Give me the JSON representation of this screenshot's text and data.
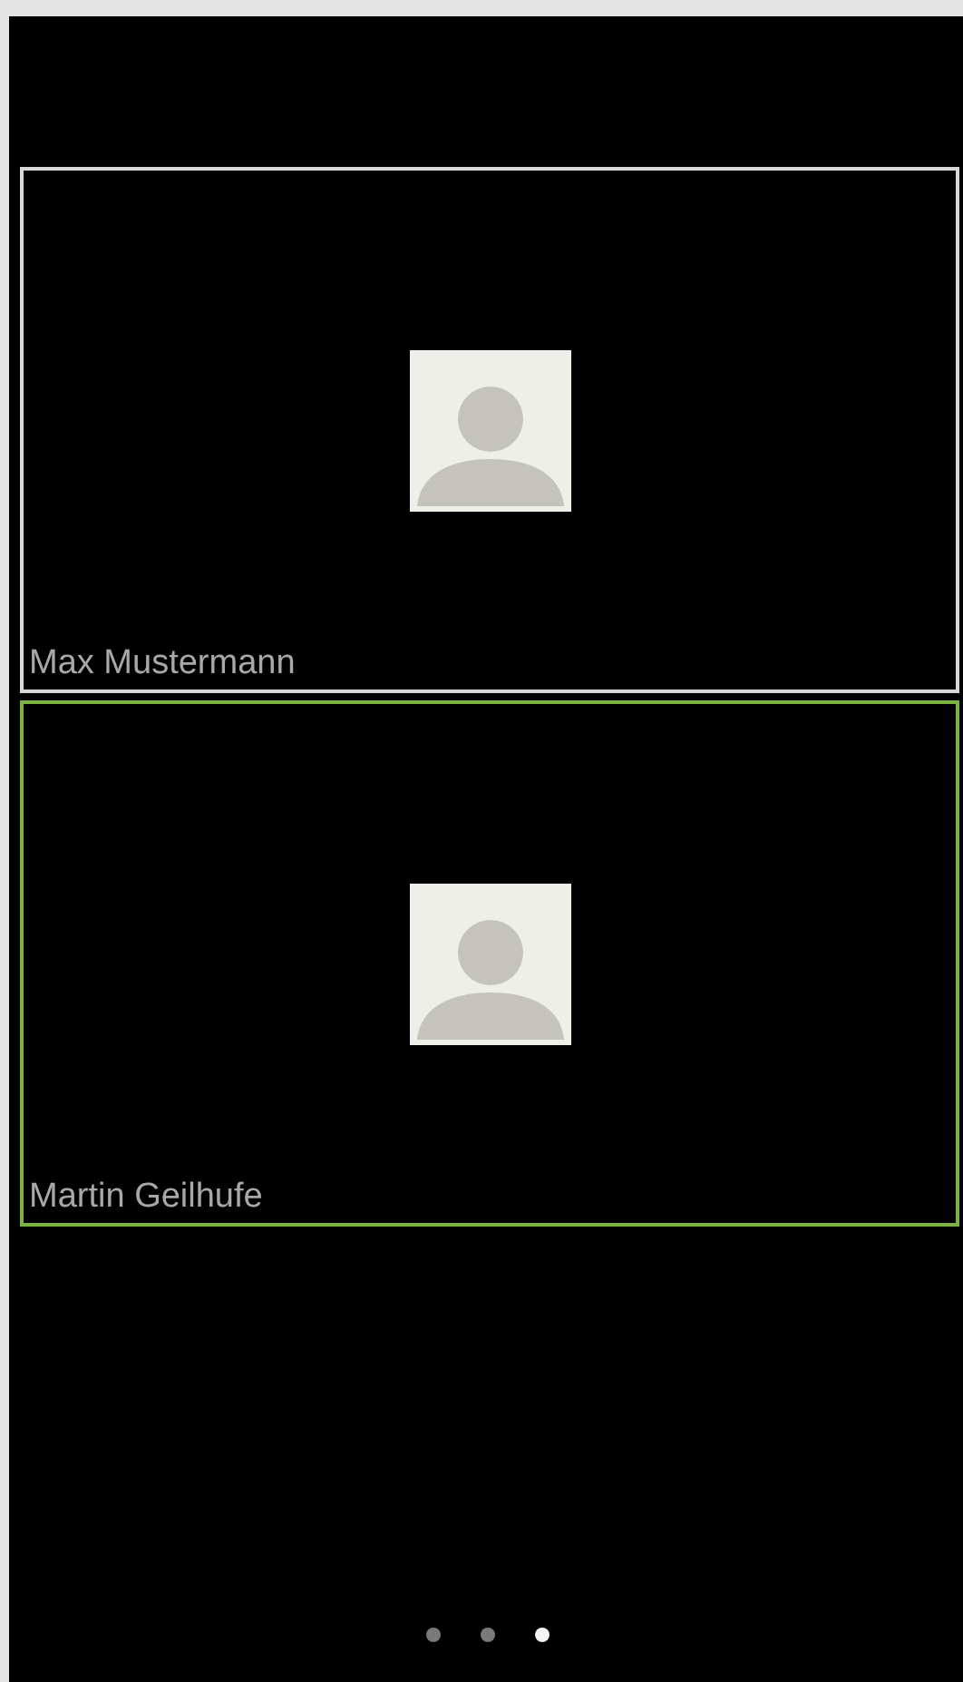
{
  "participants": [
    {
      "name": "Max Mustermann",
      "selected": false
    },
    {
      "name": "Martin Geilhufe",
      "selected": true
    }
  ],
  "pages": [
    {
      "selected": false
    },
    {
      "selected": false
    },
    {
      "selected": true
    }
  ]
}
